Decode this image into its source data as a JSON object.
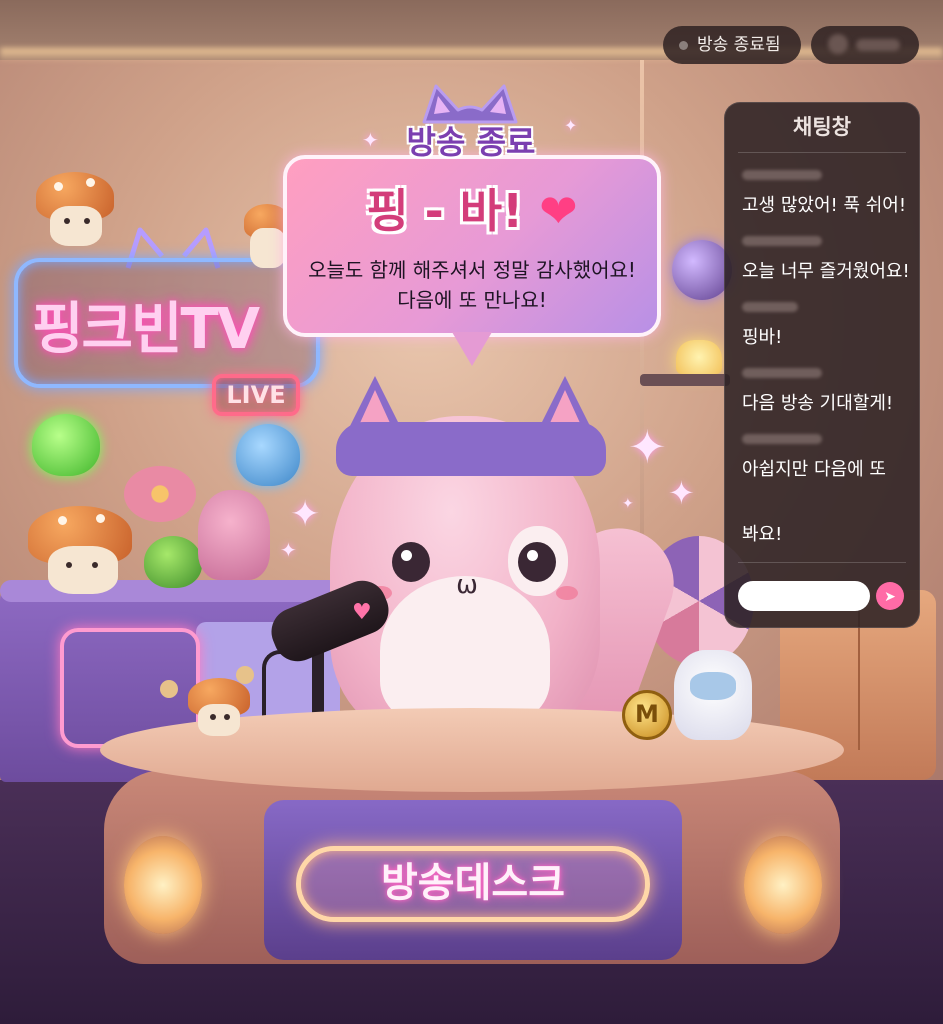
{
  "status": {
    "label": "방송 종료됨"
  },
  "user": {
    "name": ""
  },
  "banner": {
    "header": "방송 종료",
    "title": "핑 - 바!",
    "heart": "❤",
    "line1": "오늘도 함께 해주셔서 정말 감사했어요!",
    "line2": "다음에 또 만나요!"
  },
  "chat": {
    "title": "채팅창",
    "messages": [
      "고생 많았어! 푹 쉬어!",
      "오늘 너무 즐거웠어요!",
      "핑바!",
      "다음 방송 기대할게!",
      "아쉽지만 다음에 또",
      "봐요!"
    ],
    "input_placeholder": "",
    "send_icon": "send-arrow-icon"
  },
  "room": {
    "neon_sign": "핑크빈TV",
    "live_badge": "LIVE",
    "desk_sign": "방송데스크",
    "coin_mark": "M"
  },
  "colors": {
    "accent": "#ff6ba6",
    "banner_title": "#d33d7a",
    "banner_header": "#7b3fb0",
    "chat_bg": "#2e2224",
    "neon_blue": "#8fb8ff",
    "neon_pink": "#ff4fb8"
  }
}
